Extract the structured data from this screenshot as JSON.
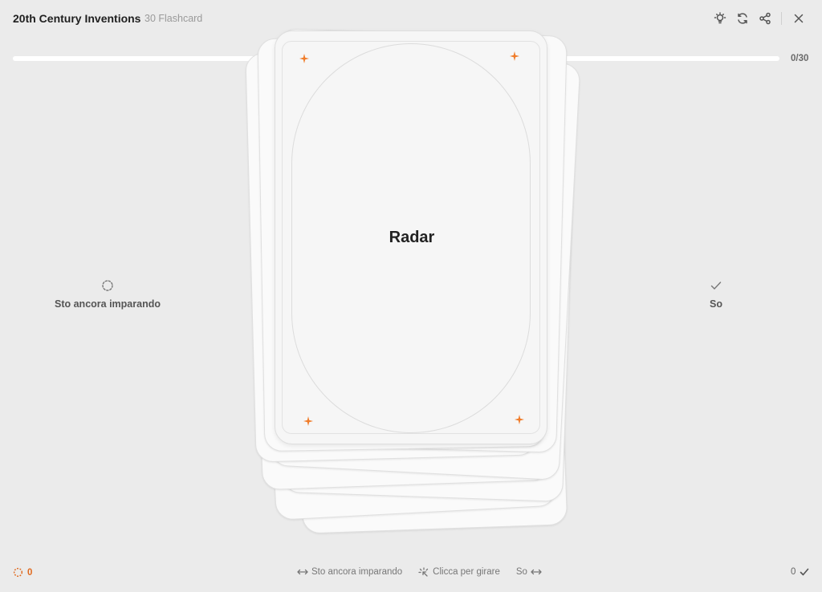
{
  "header": {
    "title": "20th Century Inventions",
    "card_count": "30 Flashcard",
    "icons": [
      "lightbulb-icon",
      "refresh-icon",
      "share-icon",
      "close-icon"
    ]
  },
  "progress": {
    "text": "0/30",
    "value": 0,
    "fill_color": "#f07c2a"
  },
  "sides": {
    "learning_label": "Sto ancora imparando",
    "known_label": "So"
  },
  "card": {
    "front_text": "Radar",
    "accent_color": "#f07c2a"
  },
  "footer": {
    "learning_count": "0",
    "hint_learning": "Sto ancora imparando",
    "hint_flip": "Clicca per girare",
    "hint_known": "So",
    "known_count": "0"
  }
}
